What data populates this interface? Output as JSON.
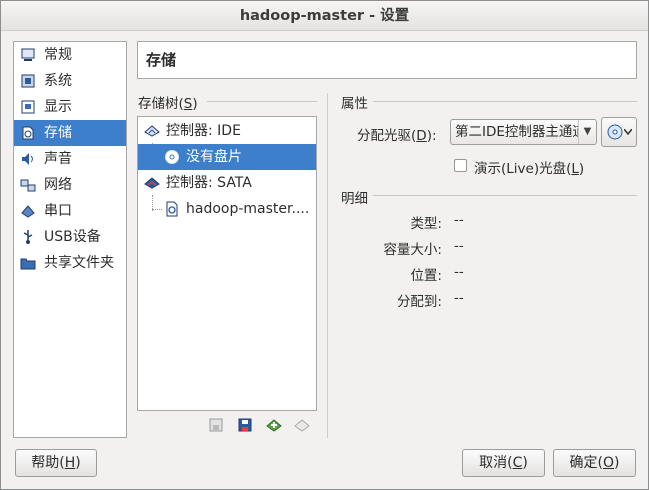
{
  "window": {
    "title": "hadoop-master - 设置"
  },
  "sidebar": {
    "items": [
      {
        "label": "常规",
        "icon": "monitor-general-icon"
      },
      {
        "label": "系统",
        "icon": "chip-icon"
      },
      {
        "label": "显示",
        "icon": "display-icon"
      },
      {
        "label": "存储",
        "icon": "storage-icon",
        "selected": true
      },
      {
        "label": "声音",
        "icon": "speaker-icon"
      },
      {
        "label": "网络",
        "icon": "network-icon"
      },
      {
        "label": "串口",
        "icon": "serial-port-icon"
      },
      {
        "label": "USB设备",
        "icon": "usb-icon"
      },
      {
        "label": "共享文件夹",
        "icon": "folder-icon"
      }
    ]
  },
  "header": {
    "title": "存储"
  },
  "storage_tree": {
    "title_pre": "存储树(",
    "title_key": "S",
    "title_post": ")",
    "nodes": [
      {
        "label": "控制器: IDE",
        "type": "controller"
      },
      {
        "label": "没有盘片",
        "type": "optical-empty",
        "selected": true
      },
      {
        "label": "控制器: SATA",
        "type": "controller"
      },
      {
        "label": "hadoop-master....",
        "type": "hard-disk"
      }
    ],
    "toolbar": [
      "add-attachment-icon",
      "remove-attachment-icon",
      "add-controller-icon",
      "remove-controller-icon"
    ]
  },
  "attributes": {
    "title": "属性",
    "drive_label_pre": "分配光驱(",
    "drive_label_key": "D",
    "drive_label_post": "):",
    "drive_value": "第二IDE控制器主通道",
    "live_pre": "演示(Live)光盘(",
    "live_key": "L",
    "live_post": ")",
    "live_checked": false
  },
  "details": {
    "title": "明细",
    "rows": [
      {
        "label": "类型:",
        "value": "--"
      },
      {
        "label": "容量大小:",
        "value": "--"
      },
      {
        "label": "位置:",
        "value": "--"
      },
      {
        "label": "分配到:",
        "value": "--"
      }
    ]
  },
  "buttons": {
    "help_pre": "帮助(",
    "help_key": "H",
    "help_post": ")",
    "cancel_pre": "取消(",
    "cancel_key": "C",
    "cancel_post": ")",
    "ok_pre": "确定(",
    "ok_key": "O",
    "ok_post": ")"
  },
  "colors": {
    "selection": "#3d7fca",
    "background": "#f2f1f0"
  }
}
